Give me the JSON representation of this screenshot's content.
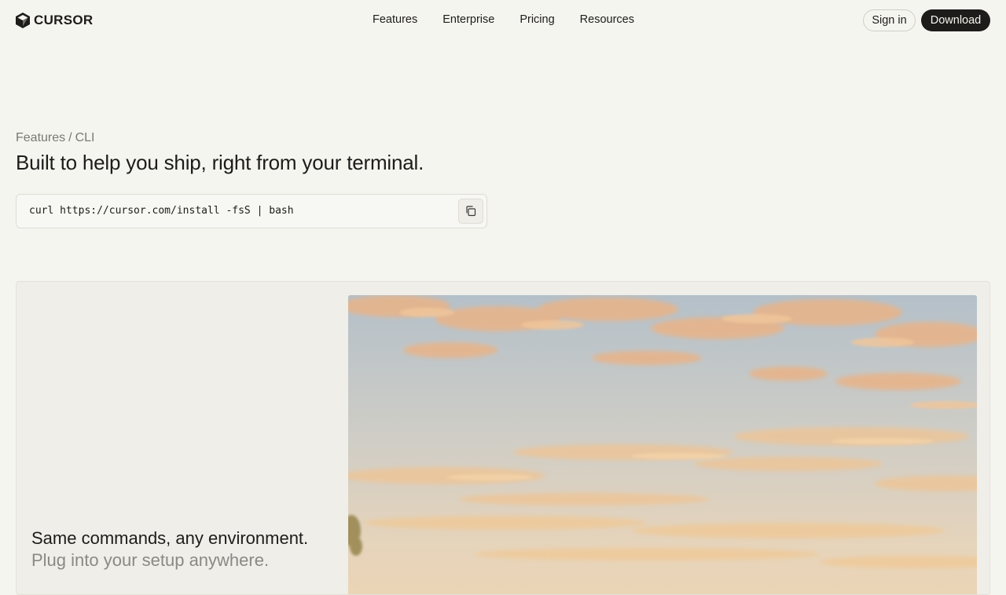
{
  "header": {
    "brand": "CURSOR",
    "nav": [
      {
        "label": "Features"
      },
      {
        "label": "Enterprise"
      },
      {
        "label": "Pricing"
      },
      {
        "label": "Resources"
      }
    ],
    "sign_in_label": "Sign in",
    "download_label": "Download"
  },
  "hero": {
    "breadcrumb": {
      "parent": "Features",
      "separator": "/",
      "current": "CLI"
    },
    "headline": "Built to help you ship, right from your terminal.",
    "install_command": "curl https://cursor.com/install -fsS | bash",
    "copy_icon": "copy-icon"
  },
  "feature_card": {
    "title": "Same commands, any environment.",
    "subtitle": "Plug into your setup anywhere.",
    "image_subject": "sunset-sky-painting"
  },
  "colors": {
    "background": "#f5f5f0",
    "text": "#1d1c1a",
    "muted": "#7a7974",
    "button_dark": "#1d1c1a",
    "card_bg": "#efeee9"
  }
}
